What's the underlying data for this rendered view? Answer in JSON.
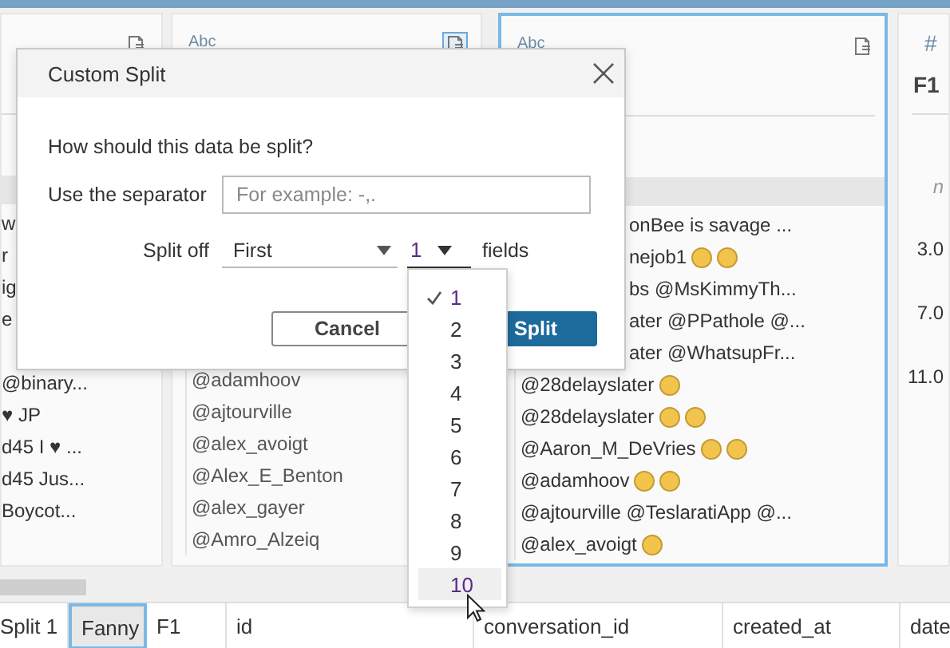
{
  "cards": [
    {
      "selected": false,
      "file_icon_active": false,
      "rows": [
        {
          "text": "w"
        },
        {
          "text": "r"
        },
        {
          "text": "ig"
        },
        {
          "text": "e"
        },
        {
          "text": "@binary..."
        },
        {
          "text": "♥ JP"
        },
        {
          "text": "d45 I ♥ ..."
        },
        {
          "text": "d45 Jus..."
        },
        {
          "text": "Boycot..."
        }
      ]
    },
    {
      "selected": false,
      "type_label": "Abc",
      "file_icon_active": true,
      "rows": [
        {
          "text": "@adamhoov"
        },
        {
          "text": "@ajtourville"
        },
        {
          "text": "@alex_avoigt"
        },
        {
          "text": "@Alex_E_Benton"
        },
        {
          "text": "@alex_gayer"
        },
        {
          "text": "@Amro_Alzeiq"
        }
      ]
    },
    {
      "selected": true,
      "type_label": "Abc",
      "file_icon_active": false,
      "rows": [
        {
          "text": "onBee is savage ..."
        },
        {
          "text": "nejob1",
          "icons": [
            {
              "kind": "emoji"
            },
            {
              "kind": "emoji"
            }
          ]
        },
        {
          "text": "bs @MsKimmyTh..."
        },
        {
          "text": "ater @PPathole @..."
        },
        {
          "text": "ater @WhatsupFr..."
        },
        {
          "text": "@28delayslater",
          "icons": [
            {
              "kind": "emoji"
            }
          ]
        },
        {
          "text": "@28delayslater",
          "icons": [
            {
              "kind": "emoji"
            },
            {
              "kind": "emoji"
            }
          ]
        },
        {
          "text": "@Aaron_M_DeVries",
          "icons": [
            {
              "kind": "emoji"
            },
            {
              "kind": "emoji"
            }
          ]
        },
        {
          "text": "@adamhoov",
          "icons": [
            {
              "kind": "emoji"
            },
            {
              "kind": "emoji"
            }
          ]
        },
        {
          "text": "@ajtourville @TeslaratiApp @..."
        },
        {
          "text": "@alex_avoigt",
          "icons": [
            {
              "kind": "emoji"
            }
          ]
        }
      ]
    },
    {
      "selected": false,
      "type_label": "#",
      "name": "F1",
      "note": "n",
      "rows": [
        {
          "text": "3.0"
        },
        {
          "text": "7.0"
        },
        {
          "text": "11.0"
        }
      ]
    }
  ],
  "columns": [
    {
      "label": "Split 1",
      "selected": false
    },
    {
      "label": "Fanny",
      "selected": true
    },
    {
      "label": "F1",
      "selected": false
    },
    {
      "label": "id",
      "selected": false
    },
    {
      "label": "conversation_id",
      "selected": false
    },
    {
      "label": "created_at",
      "selected": false
    },
    {
      "label": "date",
      "selected": false
    }
  ],
  "dialog": {
    "title": "Custom Split",
    "question": "How should this data be split?",
    "separator_label": "Use the separator",
    "separator_placeholder": "For example: -,.",
    "split_off_label": "Split off",
    "position_value": "First",
    "count_value": "1",
    "fields_label": "fields",
    "buttons": [
      {
        "label": "Cancel",
        "kind": "secondary"
      },
      {
        "label": "Split",
        "kind": "primary"
      }
    ]
  },
  "count_menu": {
    "items": [
      {
        "label": "1",
        "selected": true,
        "hovered": false
      },
      {
        "label": "2",
        "selected": false,
        "hovered": false
      },
      {
        "label": "3",
        "selected": false,
        "hovered": false
      },
      {
        "label": "4",
        "selected": false,
        "hovered": false
      },
      {
        "label": "5",
        "selected": false,
        "hovered": false
      },
      {
        "label": "6",
        "selected": false,
        "hovered": false
      },
      {
        "label": "7",
        "selected": false,
        "hovered": false
      },
      {
        "label": "8",
        "selected": false,
        "hovered": false
      },
      {
        "label": "9",
        "selected": false,
        "hovered": false
      },
      {
        "label": "10",
        "selected": false,
        "hovered": true
      }
    ]
  }
}
